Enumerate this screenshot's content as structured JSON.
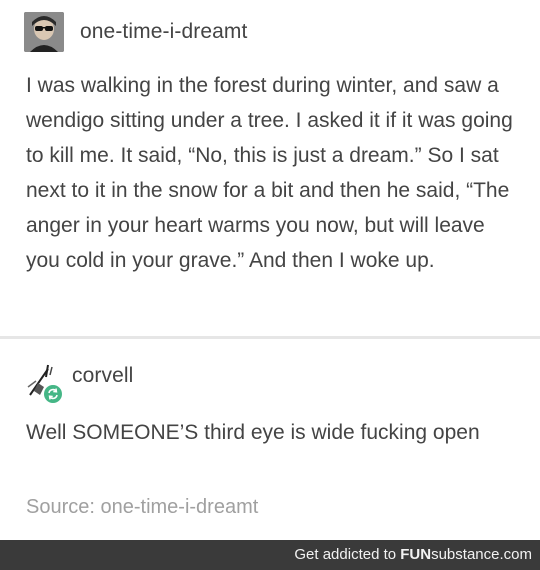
{
  "post1": {
    "username": "one-time-i-dreamt",
    "body": "I was walking in the forest during winter, and saw a wendigo sitting under a tree. I asked it if it was going to kill me. It said, “No, this is just a dream.” So I sat next to it in the snow for a bit and then he said, “The anger in your heart warms you now, but will leave you cold in your grave.” And then I woke up."
  },
  "post2": {
    "username": "corvell",
    "body": "Well SOMEONE’S third eye is wide fucking open",
    "source": "Source: one-time-i-dreamt",
    "badge_icon": "reblog-icon",
    "badge_color": "#45b686"
  },
  "footer": {
    "prefix": "Get addicted to",
    "brand_bold": "FUN",
    "brand_rest": "substance",
    "brand_suffix": ".com"
  }
}
